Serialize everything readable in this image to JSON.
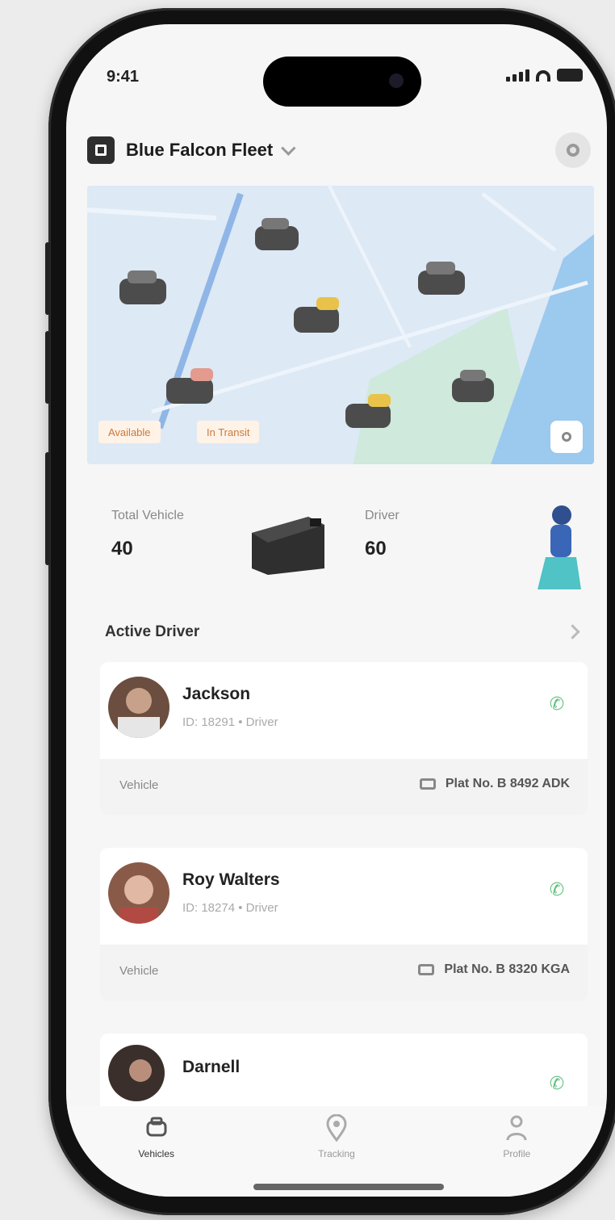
{
  "status_bar": {
    "time": "9:41"
  },
  "header": {
    "fleet_name": "Blue Falcon Fleet"
  },
  "map": {
    "chips": [
      "Available",
      "In Transit"
    ]
  },
  "stats": [
    {
      "label": "Total Vehicle",
      "value": "40"
    },
    {
      "label": "Driver",
      "value": "60"
    }
  ],
  "active_drivers": {
    "title": "Active Driver",
    "drivers": [
      {
        "name": "Jackson",
        "subtitle": "ID: 18291 • Driver",
        "vehicle_label": "Vehicle",
        "plate": "Plat No. B 8492 ADK"
      },
      {
        "name": "Roy Walters",
        "subtitle": "ID: 18274 • Driver",
        "vehicle_label": "Vehicle",
        "plate": "Plat No. B 8320 KGA"
      },
      {
        "name": "Darnell",
        "subtitle": "",
        "vehicle_label": "",
        "plate": ""
      }
    ]
  },
  "tabs": [
    {
      "label": "Vehicles",
      "icon": "car-icon",
      "active": true
    },
    {
      "label": "Tracking",
      "icon": "location-icon",
      "active": false
    },
    {
      "label": "Profile",
      "icon": "person-icon",
      "active": false
    }
  ],
  "colors": {
    "accent_green": "#5ec07c",
    "chip_orange": "#c97a3a",
    "map_bg": "#dbe8f4"
  }
}
